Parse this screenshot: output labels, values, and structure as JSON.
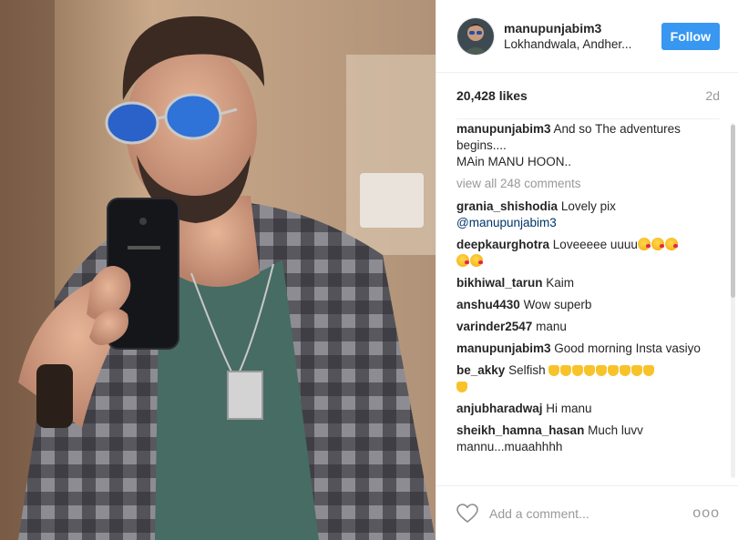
{
  "post": {
    "username": "manupunjabim3",
    "location": "Lokhandwala, Andher...",
    "follow_label": "Follow",
    "likes": "20,428 likes",
    "age": "2d"
  },
  "caption": {
    "username": "manupunjabim3",
    "line1": "And so The adventures begins....",
    "line2": "MAin MANU HOON.."
  },
  "view_all": "view all 248 comments",
  "comments": [
    {
      "user": "grania_shishodia",
      "text": "Lovely pix",
      "mention": "@manupunjabim3"
    },
    {
      "user": "deepkaurghotra",
      "text": "Loveeeee uuuu",
      "emoji": "kissing-heart-emoji"
    },
    {
      "user": "bikhiwal_tarun",
      "text": "Kaim"
    },
    {
      "user": "anshu4430",
      "text": "Wow superb"
    },
    {
      "user": "varinder2547",
      "text": "manu"
    },
    {
      "user": "manupunjabim3",
      "text": "Good morning Insta vasiyo"
    },
    {
      "user": "be_akky",
      "text": "Selfish",
      "emoji": "thumbs-down-emoji"
    },
    {
      "user": "anjubharadwaj",
      "text": "Hi manu"
    },
    {
      "user": "sheikh_hamna_hasan",
      "text": "Much luvv mannu...muaahhhh"
    }
  ],
  "footer": {
    "placeholder": "Add a comment...",
    "more": "ooo"
  },
  "colors": {
    "follow_bg": "#3897f0",
    "muted": "#999999",
    "mention": "#003569"
  }
}
